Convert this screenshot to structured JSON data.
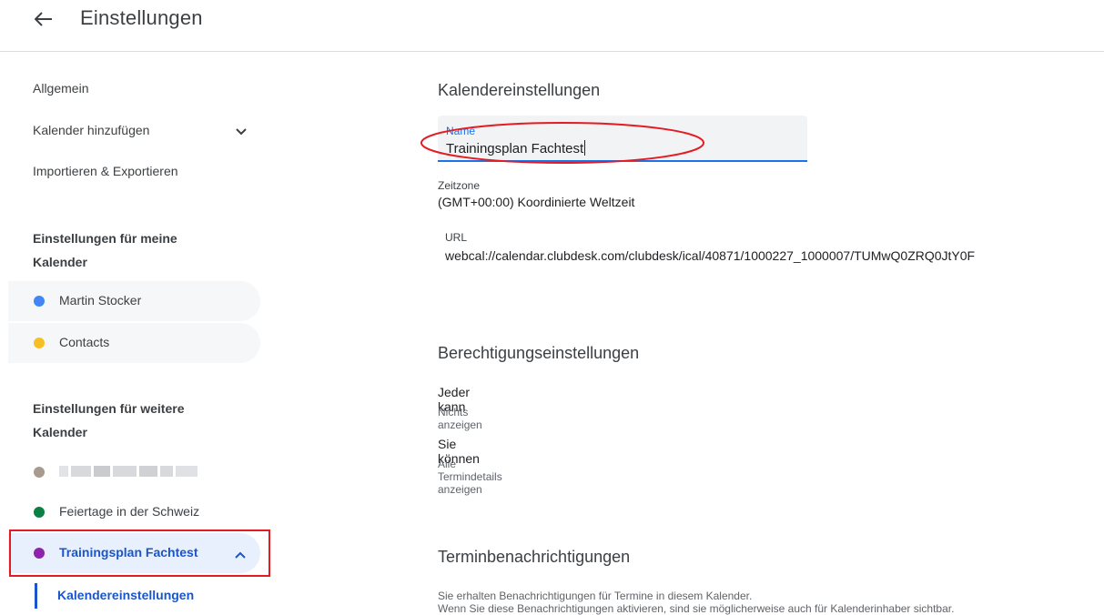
{
  "header": {
    "title": "Einstellungen"
  },
  "sidebar": {
    "general": "Allgemein",
    "add_calendar": "Kalender hinzufügen",
    "import_export": "Importieren & Exportieren",
    "my_calendars_heading": "Einstellungen für meine Kalender",
    "my_calendars": [
      {
        "label": "Martin Stocker",
        "color": "#4285f4"
      },
      {
        "label": "Contacts",
        "color": "#f6bf26"
      }
    ],
    "other_calendars_heading": "Einstellungen für weitere Kalender",
    "other_calendars": [
      {
        "label": "",
        "color": "#a79b8e",
        "redacted": true
      },
      {
        "label": "Feiertage in der Schweiz",
        "color": "#0b8043"
      },
      {
        "label": "Trainingsplan Fachtest",
        "color": "#8e24aa",
        "selected": true
      }
    ],
    "sub_item": "Kalendereinstellungen"
  },
  "main": {
    "calendar_settings": {
      "heading": "Kalendereinstellungen",
      "name_label": "Name",
      "name_value": "Trainingsplan Fachtest",
      "timezone_label": "Zeitzone",
      "timezone_value": "(GMT+00:00) Koordinierte Weltzeit",
      "url_label": "URL",
      "url_value": "webcal://calendar.clubdesk.com/clubdesk/ical/40871/1000227_1000007/TUMwQ0ZRQ0JtY0F"
    },
    "permissions": {
      "heading": "Berechtigungseinstellungen",
      "anyone_title": "Jeder kann",
      "anyone_value": "Nichts anzeigen",
      "you_title": "Sie können",
      "you_value": "Alle Termindetails anzeigen"
    },
    "notifications": {
      "heading": "Terminbenachrichtigungen",
      "line1": "Sie erhalten Benachrichtigungen für Termine in diesem Kalender.",
      "line2": "Wenn Sie diese Benachrichtigungen aktivieren, sind sie möglicherweise auch für Kalenderinhaber sichtbar."
    }
  },
  "colors": {
    "accent": "#1a73e8",
    "annotation": "#e51b23"
  }
}
